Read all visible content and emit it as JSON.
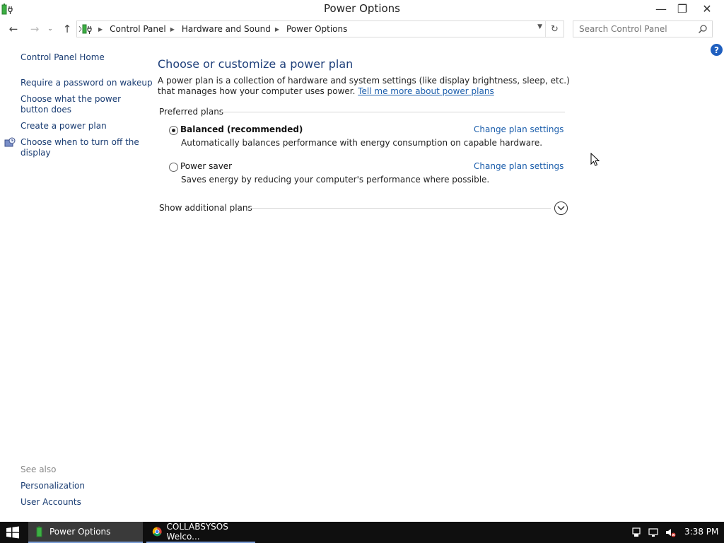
{
  "window": {
    "title": "Power Options",
    "minimize_glyph": "—",
    "maximize_glyph": "❐",
    "close_glyph": "✕"
  },
  "nav": {
    "back_glyph": "←",
    "forward_glyph": "→",
    "recent_glyph": "⌄",
    "up_glyph": "↑",
    "breadcrumbs": [
      {
        "label": "Control Panel"
      },
      {
        "label": "Hardware and Sound"
      },
      {
        "label": "Power Options"
      }
    ],
    "refresh_glyph": "↻",
    "search_placeholder": "Search Control Panel"
  },
  "help": {
    "glyph": "?"
  },
  "left_pane": {
    "home": "Control Panel Home",
    "links": [
      "Require a password on wakeup",
      "Choose what the power button does",
      "Create a power plan",
      "Choose when to turn off the display"
    ],
    "see_also_label": "See also",
    "see_also": [
      "Personalization",
      "User Accounts"
    ]
  },
  "main": {
    "title": "Choose or customize a power plan",
    "description": "A power plan is a collection of hardware and system settings (like display brightness, sleep, etc.) that manages how your computer uses power.",
    "learn_more": "Tell me more about power plans",
    "section_header": "Preferred plans",
    "plans": [
      {
        "name": "Balanced (recommended)",
        "selected": true,
        "description": "Automatically balances performance with energy consumption on capable hardware.",
        "link": "Change plan settings"
      },
      {
        "name": "Power saver",
        "selected": false,
        "description": "Saves energy by reducing your computer's performance where possible.",
        "link": "Change plan settings"
      }
    ],
    "show_additional": "Show additional plans"
  },
  "taskbar": {
    "items": [
      "Power Options",
      "COLLABSYSOS Welco..."
    ],
    "clock": "3:38 PM"
  },
  "colors": {
    "link": "#1a5dab",
    "title": "#1e3f7a",
    "taskbar": "#0f0f0f",
    "battery_green": "#3cb043"
  }
}
